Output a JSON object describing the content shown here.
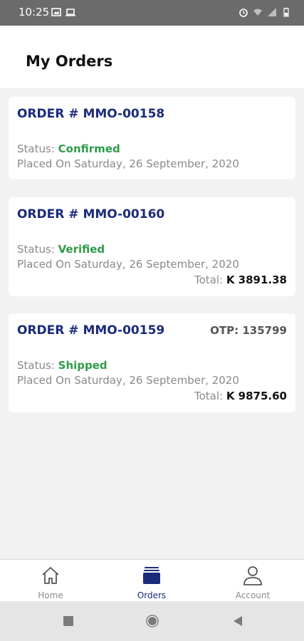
{
  "status_bar": {
    "time": "10:25",
    "left_icons": [
      "image-icon",
      "monitor-icon"
    ],
    "right_icons": [
      "alarm-icon",
      "wifi-icon",
      "signal-icon",
      "battery-icon"
    ]
  },
  "header": {
    "title": "My Orders"
  },
  "orders": [
    {
      "number": "ORDER # MMO-00158",
      "status_label": "Status:",
      "status_value": "Confirmed",
      "placed": "Placed On Saturday, 26 September, 2020"
    },
    {
      "number": "ORDER # MMO-00160",
      "status_label": "Status:",
      "status_value": "Verified",
      "placed": "Placed On Saturday, 26 September, 2020",
      "total_label": "Total:",
      "total_value": "K 3891.38"
    },
    {
      "number": "ORDER # MMO-00159",
      "otp": "OTP: 135799",
      "status_label": "Status:",
      "status_value": "Shipped",
      "placed": "Placed On Saturday, 26 September, 2020",
      "total_label": "Total:",
      "total_value": "K 9875.60"
    }
  ],
  "bottom_nav": [
    {
      "label": "Home",
      "icon": "home-icon",
      "active": false
    },
    {
      "label": "Orders",
      "icon": "orders-icon",
      "active": true
    },
    {
      "label": "Account",
      "icon": "account-icon",
      "active": false
    }
  ],
  "android_nav": [
    "recents-icon",
    "home-circle-icon",
    "back-icon"
  ],
  "colors": {
    "accent": "#1b2a7a",
    "status_green": "#2e9b48",
    "muted_text": "#8a8a8a",
    "status_bar": "#6b6b6b",
    "background": "#f2f2f2"
  }
}
